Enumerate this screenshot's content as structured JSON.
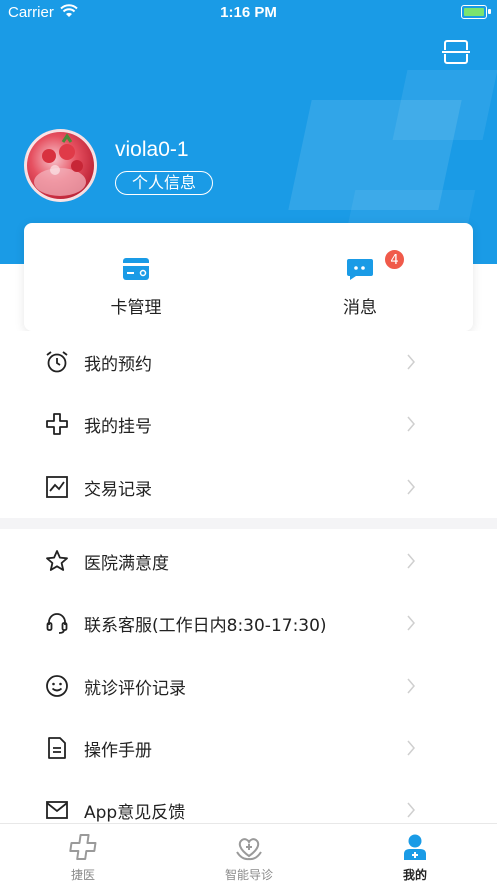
{
  "status_bar": {
    "carrier": "Carrier",
    "time": "1:16 PM"
  },
  "profile": {
    "username": "viola0-1",
    "info_button": "个人信息"
  },
  "quick_card": {
    "card_label": "卡管理",
    "messages_label": "消息",
    "messages_badge": "4"
  },
  "menu_group_1": [
    {
      "label": "我的预约",
      "icon": "alarm-clock-icon"
    },
    {
      "label": "我的挂号",
      "icon": "plus-cross-icon"
    },
    {
      "label": "交易记录",
      "icon": "chart-icon"
    }
  ],
  "menu_group_2": [
    {
      "label": "医院满意度",
      "icon": "star-icon"
    },
    {
      "label": "联系客服(工作日内8:30-17:30)",
      "icon": "headset-icon"
    },
    {
      "label": "就诊评价记录",
      "icon": "smile-icon"
    },
    {
      "label": "操作手册",
      "icon": "document-icon"
    },
    {
      "label": "App意见反馈",
      "icon": "mail-icon"
    }
  ],
  "tab_bar": [
    {
      "label": "捷医",
      "icon": "medical-cross-icon"
    },
    {
      "label": "智能导诊",
      "icon": "heart-hand-icon"
    },
    {
      "label": "我的",
      "icon": "user-icon",
      "active": true
    }
  ],
  "colors": {
    "brand": "#1a9be6",
    "badge": "#f05a4a"
  }
}
